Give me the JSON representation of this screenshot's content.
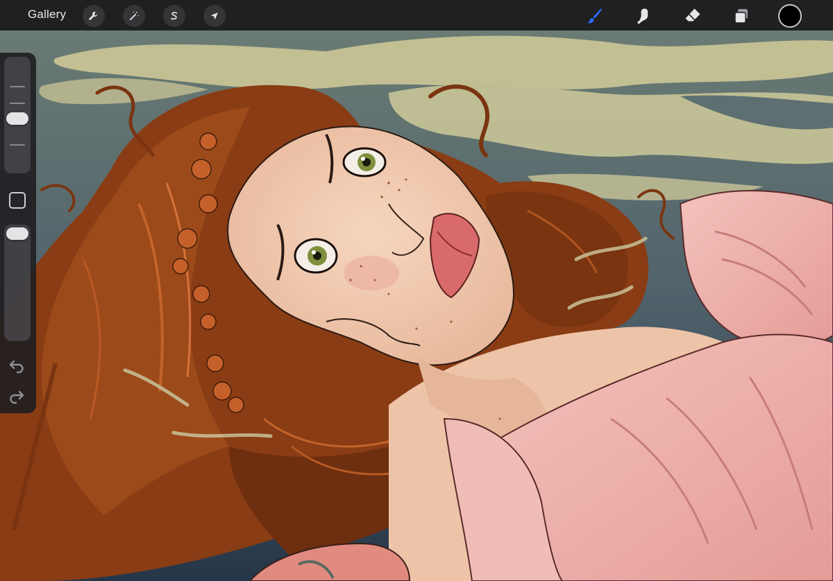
{
  "toolbar": {
    "gallery_label": "Gallery",
    "left_tools": [
      {
        "name": "actions",
        "icon": "wrench-icon"
      },
      {
        "name": "adjustments",
        "icon": "magic-wand-icon"
      },
      {
        "name": "selection",
        "icon": "selection-s-icon"
      },
      {
        "name": "transform",
        "icon": "arrow-cursor-icon"
      }
    ],
    "right_tools": [
      {
        "name": "brush",
        "icon": "brush-icon",
        "active": true
      },
      {
        "name": "smudge",
        "icon": "smudge-finger-icon",
        "active": false
      },
      {
        "name": "eraser",
        "icon": "eraser-icon",
        "active": false
      },
      {
        "name": "layers",
        "icon": "layers-icon",
        "active": false
      }
    ],
    "current_color": "#000000",
    "active_tool_color": "#2f6bff"
  },
  "sidebar": {
    "brush_size_level": 0.55,
    "opacity_level": 0.95,
    "modify_icon": "square-modify-icon",
    "undo_icon": "undo-arrow-icon",
    "redo_icon": "redo-arrow-icon"
  },
  "canvas": {
    "artwork": "digital-painting-portrait",
    "sky_color": "#5b6d70",
    "cloud_color": "#c6c294",
    "hair_color": "#8a3c14",
    "skin_color": "#f0cbb0",
    "dress_color": "#efb3ad"
  }
}
